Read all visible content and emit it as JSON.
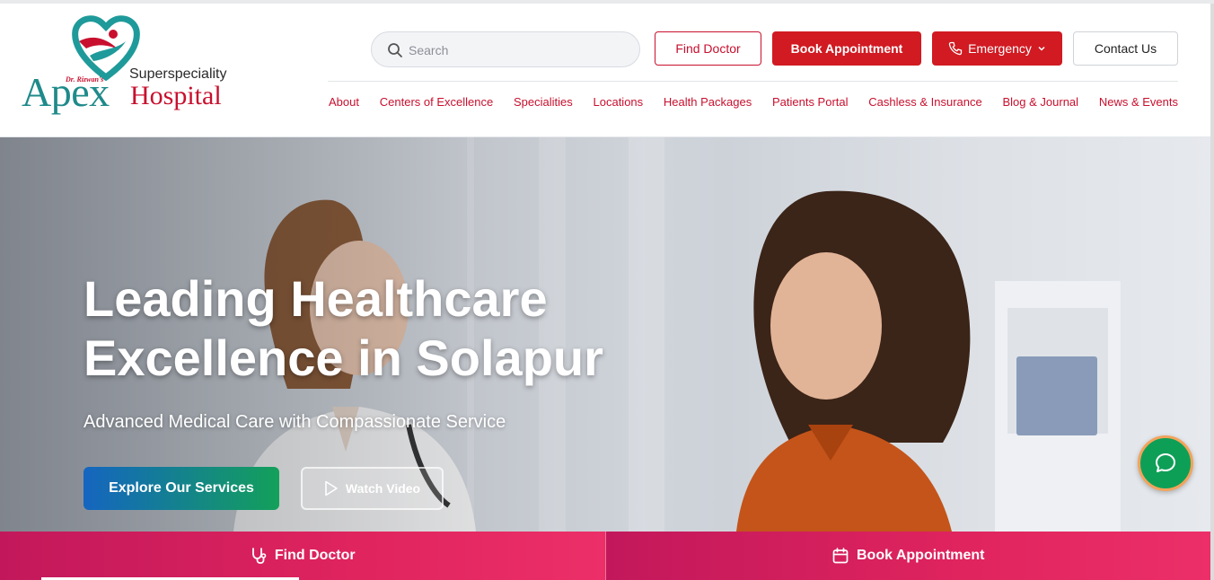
{
  "logo": {
    "small_name": "Dr. Rizwan's",
    "tagline": "Superspeciality",
    "name": "Apex",
    "name_suffix": "Hospital",
    "icon": "heart-person-logo",
    "colors": {
      "teal": "#1f8a8a",
      "red": "#c8102e"
    }
  },
  "search": {
    "placeholder": "Search",
    "value": "",
    "icon": "search-icon"
  },
  "actions": {
    "find_doctor": "Find Doctor",
    "book_appointment": "Book Appointment",
    "emergency": "Emergency",
    "contact_us": "Contact Us"
  },
  "nav": [
    "About",
    "Centers of Excellence",
    "Specialities",
    "Locations",
    "Health Packages",
    "Patients Portal",
    "Cashless & Insurance",
    "Blog & Journal",
    "News & Events"
  ],
  "hero": {
    "title_line1": "Leading Healthcare",
    "title_line2": "Excellence in Solapur",
    "subtitle": "Advanced Medical Care with Compassionate Service",
    "explore_button": "Explore Our Services",
    "watch_button": "Watch Video"
  },
  "chat": {
    "icon": "chat-bubble-icon",
    "color": "#0e9f57"
  },
  "bottom_bar": {
    "find_doctor": "Find Doctor",
    "find_doctor_icon": "stethoscope-icon",
    "book_appointment": "Book Appointment",
    "book_appointment_icon": "calendar-icon"
  },
  "colors": {
    "brand_red": "#d11a22",
    "nav_text": "#c8102e",
    "bottom_bar_pink": "#e0245e"
  }
}
